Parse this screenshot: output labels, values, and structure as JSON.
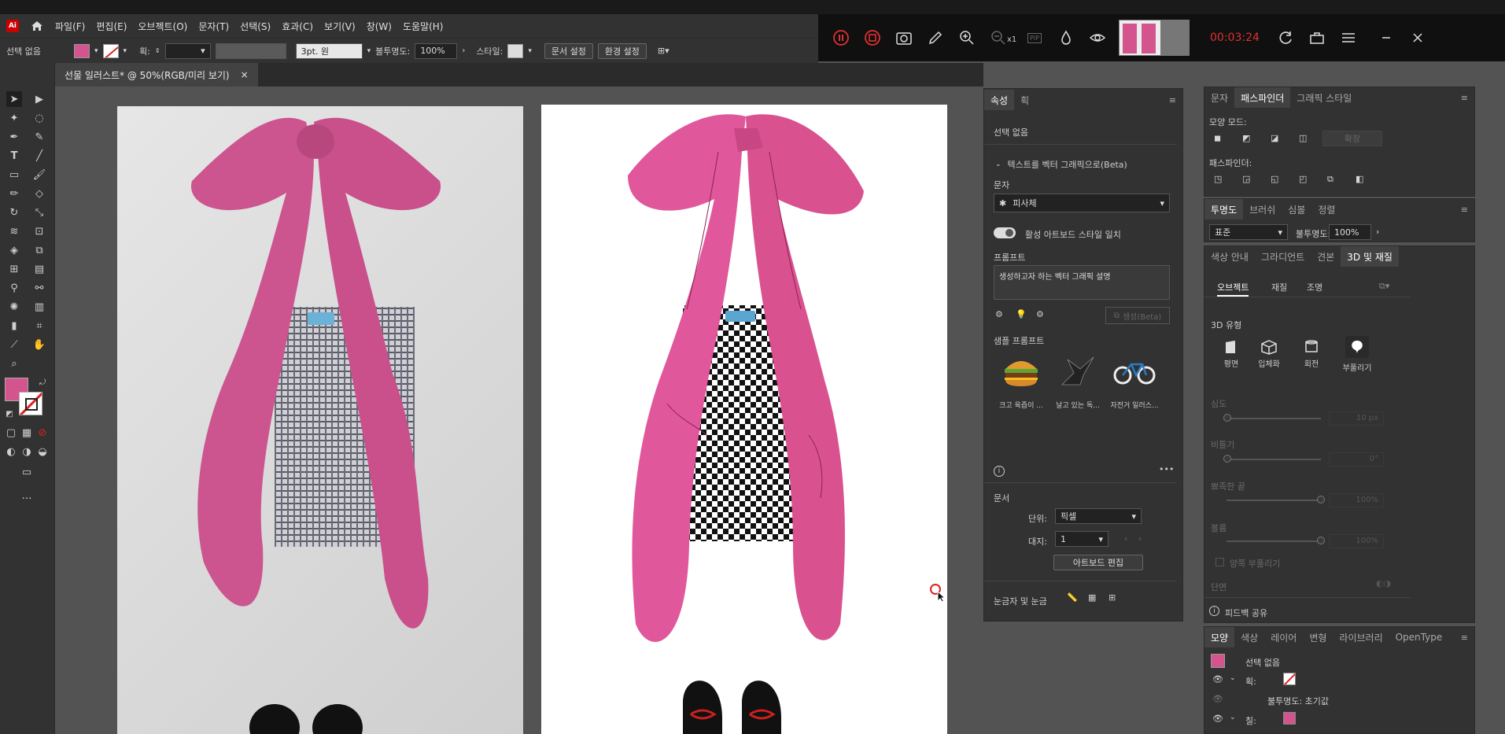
{
  "app": {
    "logo": "Ai"
  },
  "menu": [
    "파일(F)",
    "편집(E)",
    "오브젝트(O)",
    "문자(T)",
    "선택(S)",
    "효과(C)",
    "보기(V)",
    "창(W)",
    "도움말(H)"
  ],
  "control": {
    "selection": "선택 없음",
    "stroke_label": "획:",
    "brush": "3pt. 원",
    "opacity_label": "불투명도:",
    "opacity_value": "100%",
    "style_label": "스타일:",
    "doc_setup": "문서 설정",
    "preferences": "환경 설정"
  },
  "recorder": {
    "timer": "00:03:24",
    "zoom": "x1",
    "pip": "PIP"
  },
  "document": {
    "tab_title": "선물 일러스트* @ 50%(RGB/미리 보기)",
    "close": "×"
  },
  "colors": {
    "fill": "#d4558e",
    "accent": "#4a90d9",
    "timer": "#e03030"
  },
  "properties": {
    "tabs": [
      "속성",
      "획"
    ],
    "no_selection": "선택 없음",
    "text_to_vector": "텍스트를 벡터 그래픽으로(Beta)",
    "type_label": "문자",
    "type_value": "피사체",
    "toggle_label": "활성 아트보드 스타일 일치",
    "prompt_label": "프롬프트",
    "prompt_value": "생성하고자 하는 벡터 그래픽 설명",
    "generate": "생성(Beta)",
    "samples_label": "샘플 프롬프트",
    "samples": [
      "크고 육즙이 ...",
      "날고 있는 독...",
      "자전거 일러스..."
    ],
    "document_label": "문서",
    "unit_label": "단위:",
    "unit_value": "픽셀",
    "artboard_label": "대지:",
    "artboard_value": "1",
    "edit_artboard": "아트보드 편집",
    "ruler_grid": "눈금자 및 눈금"
  },
  "pathfinder": {
    "tabs": [
      "문자",
      "패스파인더",
      "그래픽 스타일"
    ],
    "shape_modes": "모양 모드:",
    "expand": "확장",
    "pathfinders": "패스파인더:"
  },
  "transparency": {
    "tabs": [
      "투명도",
      "브러쉬",
      "심볼",
      "정렬"
    ],
    "blend": "표준",
    "opacity_label": "불투명도:",
    "opacity_value": "100%"
  },
  "three_d": {
    "tabs": [
      "색상 안내",
      "그라디언트",
      "견본",
      "3D 및 재질"
    ],
    "subtabs": [
      "오브젝트",
      "재질",
      "조명"
    ],
    "type_label": "3D 유형",
    "types": [
      "평면",
      "입체화",
      "회전",
      "부풀리기"
    ],
    "depth": "심도",
    "depth_val": "10 px",
    "twist": "비틀기",
    "twist_val": "0°",
    "taper": "뾰족한 끝",
    "taper_val": "100%",
    "volume": "볼륨",
    "volume_val": "100%",
    "both_sides": "양쪽 부풀리기",
    "bevel": "단면",
    "feedback": "피드백 공유"
  },
  "appearance": {
    "tabs": [
      "모양",
      "색상",
      "레이어",
      "변형",
      "라이브러리",
      "OpenType"
    ],
    "no_selection": "선택 없음",
    "stroke": "획:",
    "opacity": "불투명도: 초기값",
    "fill": "칠:"
  }
}
